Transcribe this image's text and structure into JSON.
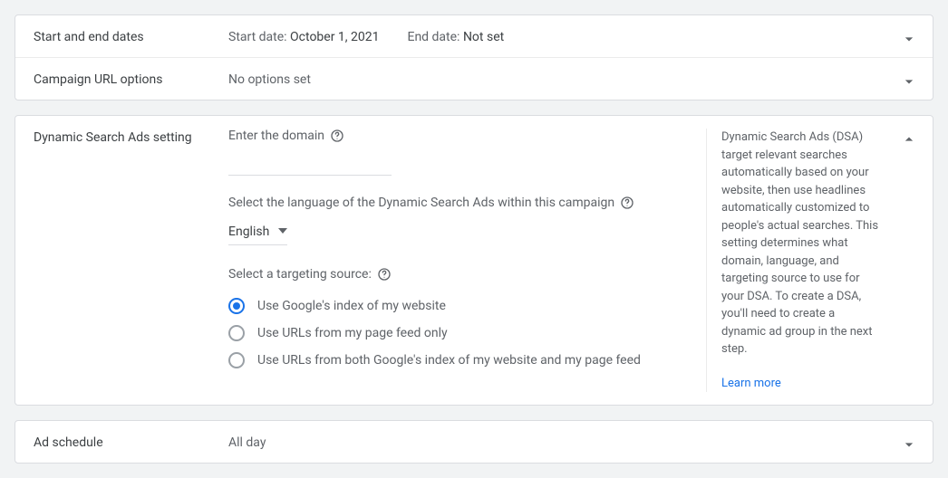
{
  "dates": {
    "title": "Start and end dates",
    "start_label": "Start date:",
    "start_value": "October 1, 2021",
    "end_label": "End date:",
    "end_value": "Not set"
  },
  "url_options": {
    "title": "Campaign URL options",
    "value": "No options set"
  },
  "dsa": {
    "title": "Dynamic Search Ads setting",
    "domain_label": "Enter the domain",
    "language_label": "Select the language of the Dynamic Search Ads within this campaign",
    "language_value": "English",
    "targeting_label": "Select a targeting source:",
    "options": [
      {
        "label": "Use Google's index of my website",
        "selected": true
      },
      {
        "label": "Use URLs from my page feed only",
        "selected": false
      },
      {
        "label": "Use URLs from both Google's index of my website and my page feed",
        "selected": false
      }
    ],
    "help_text": "Dynamic Search Ads (DSA) target relevant searches automatically based on your website, then use headlines automatically customized to people's actual searches. This setting determines what domain, language, and targeting source to use for your DSA. To create a DSA, you'll need to create a dynamic ad group in the next step.",
    "learn_more": "Learn more"
  },
  "ad_schedule": {
    "title": "Ad schedule",
    "value": "All day"
  }
}
